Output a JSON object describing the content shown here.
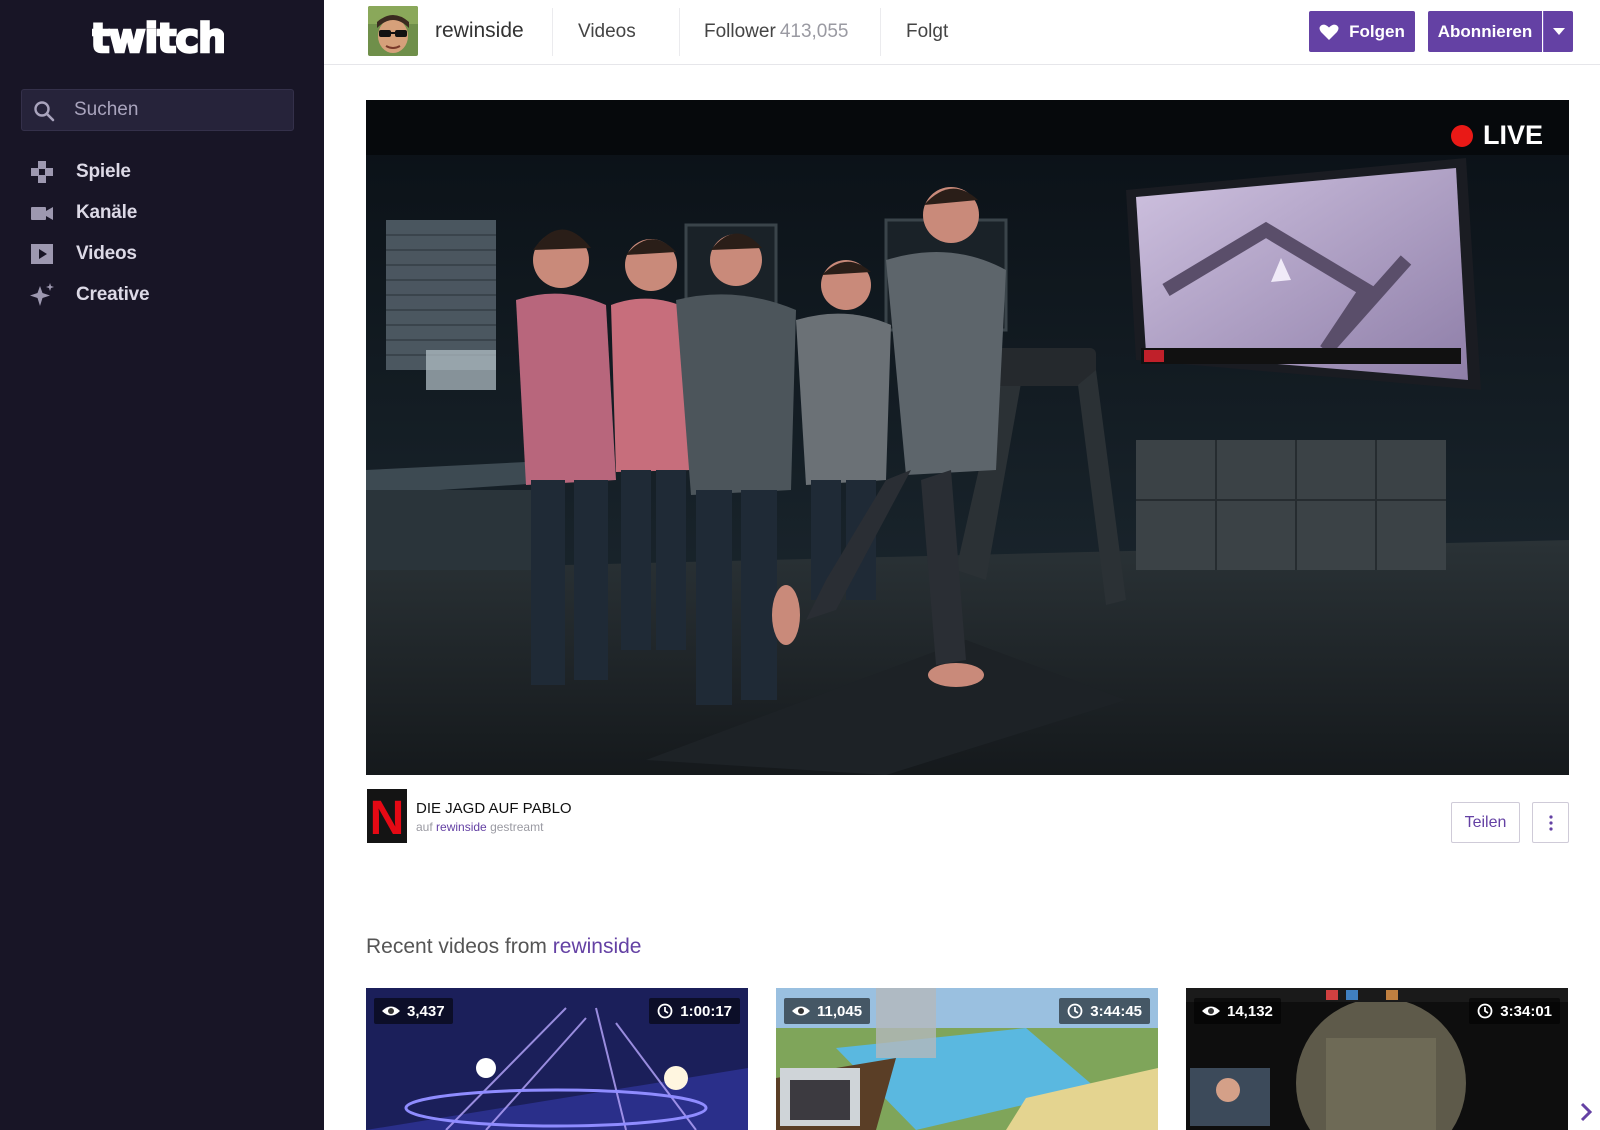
{
  "brand": {
    "logo_text": "twitch",
    "accent": "#6441a4",
    "sidebar_bg": "#181526"
  },
  "sidebar": {
    "search_placeholder": "Suchen",
    "items": [
      {
        "label": "Spiele",
        "icon": "gamepad-icon"
      },
      {
        "label": "Kanäle",
        "icon": "camera-icon"
      },
      {
        "label": "Videos",
        "icon": "play-icon"
      },
      {
        "label": "Creative",
        "icon": "sparkle-icon"
      }
    ]
  },
  "header": {
    "channel_name": "rewinside",
    "tabs": {
      "videos": "Videos",
      "follower_label": "Follower",
      "follower_count": "413,055",
      "following": "Folgt"
    },
    "follow_button": "Folgen",
    "subscribe_button": "Abonnieren"
  },
  "player": {
    "live_label": "LIVE",
    "live_color": "#e91916"
  },
  "stream": {
    "game_logo_letter": "N",
    "title": "DIE JAGD AUF PABLO",
    "sub_prefix": "auf",
    "sub_channel": "rewinside",
    "sub_suffix": "gestreamt",
    "share_button": "Teilen"
  },
  "recent": {
    "heading_prefix": "Recent videos from",
    "heading_channel": "rewinside",
    "videos": [
      {
        "views": "3,437",
        "duration": "1:00:17"
      },
      {
        "views": "11,045",
        "duration": "3:44:45"
      },
      {
        "views": "14,132",
        "duration": "3:34:01"
      }
    ]
  }
}
